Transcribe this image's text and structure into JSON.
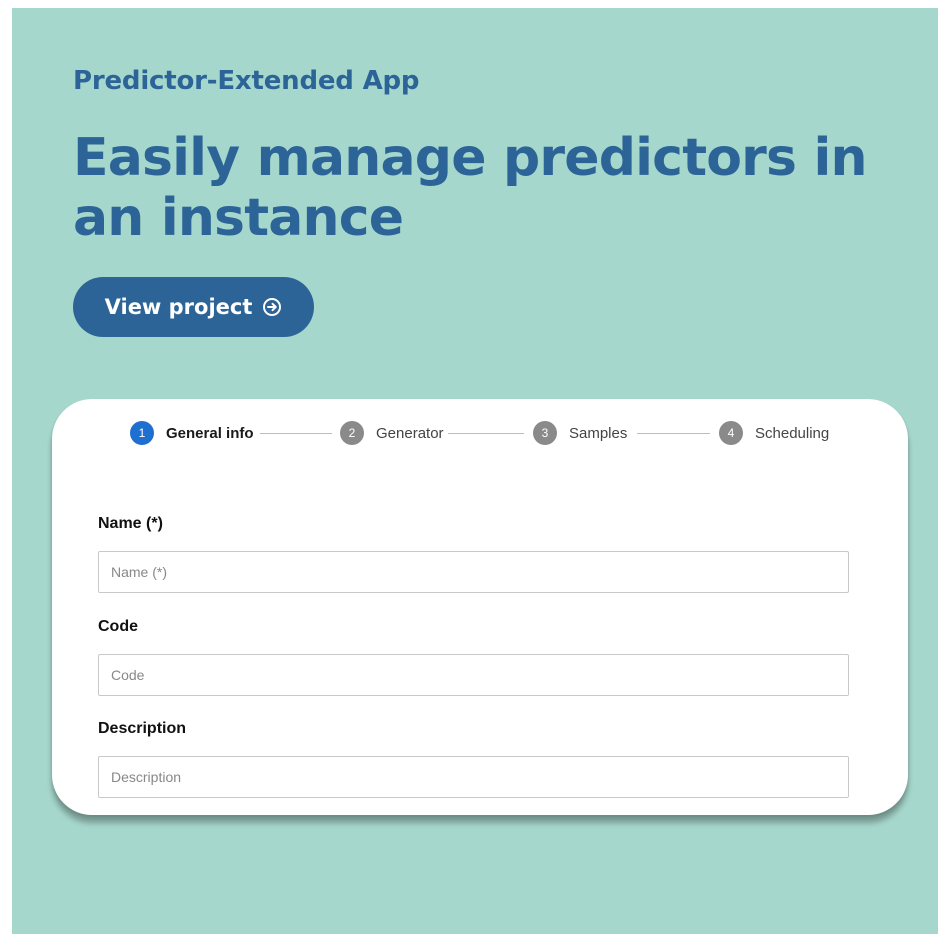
{
  "hero": {
    "kicker": "Predictor-Extended App",
    "headline": "Easily manage predictors in an instance",
    "cta_label": "View project",
    "cta_icon": "arrow-right-circle-icon"
  },
  "stepper": {
    "active_index": 0,
    "steps": [
      {
        "number": "1",
        "label": "General info"
      },
      {
        "number": "2",
        "label": "Generator"
      },
      {
        "number": "3",
        "label": "Samples"
      },
      {
        "number": "4",
        "label": "Scheduling"
      }
    ]
  },
  "form": {
    "name_label": "Name (*)",
    "name_placeholder": "Name (*)",
    "name_value": "",
    "code_label": "Code",
    "code_placeholder": "Code",
    "code_value": "",
    "description_label": "Description",
    "description_placeholder": "Description",
    "description_value": ""
  },
  "colors": {
    "background": "#a6d7cc",
    "brand_blue": "#2c6497",
    "active_step": "#1f6fd1",
    "inactive_step": "#8a8a8a"
  }
}
